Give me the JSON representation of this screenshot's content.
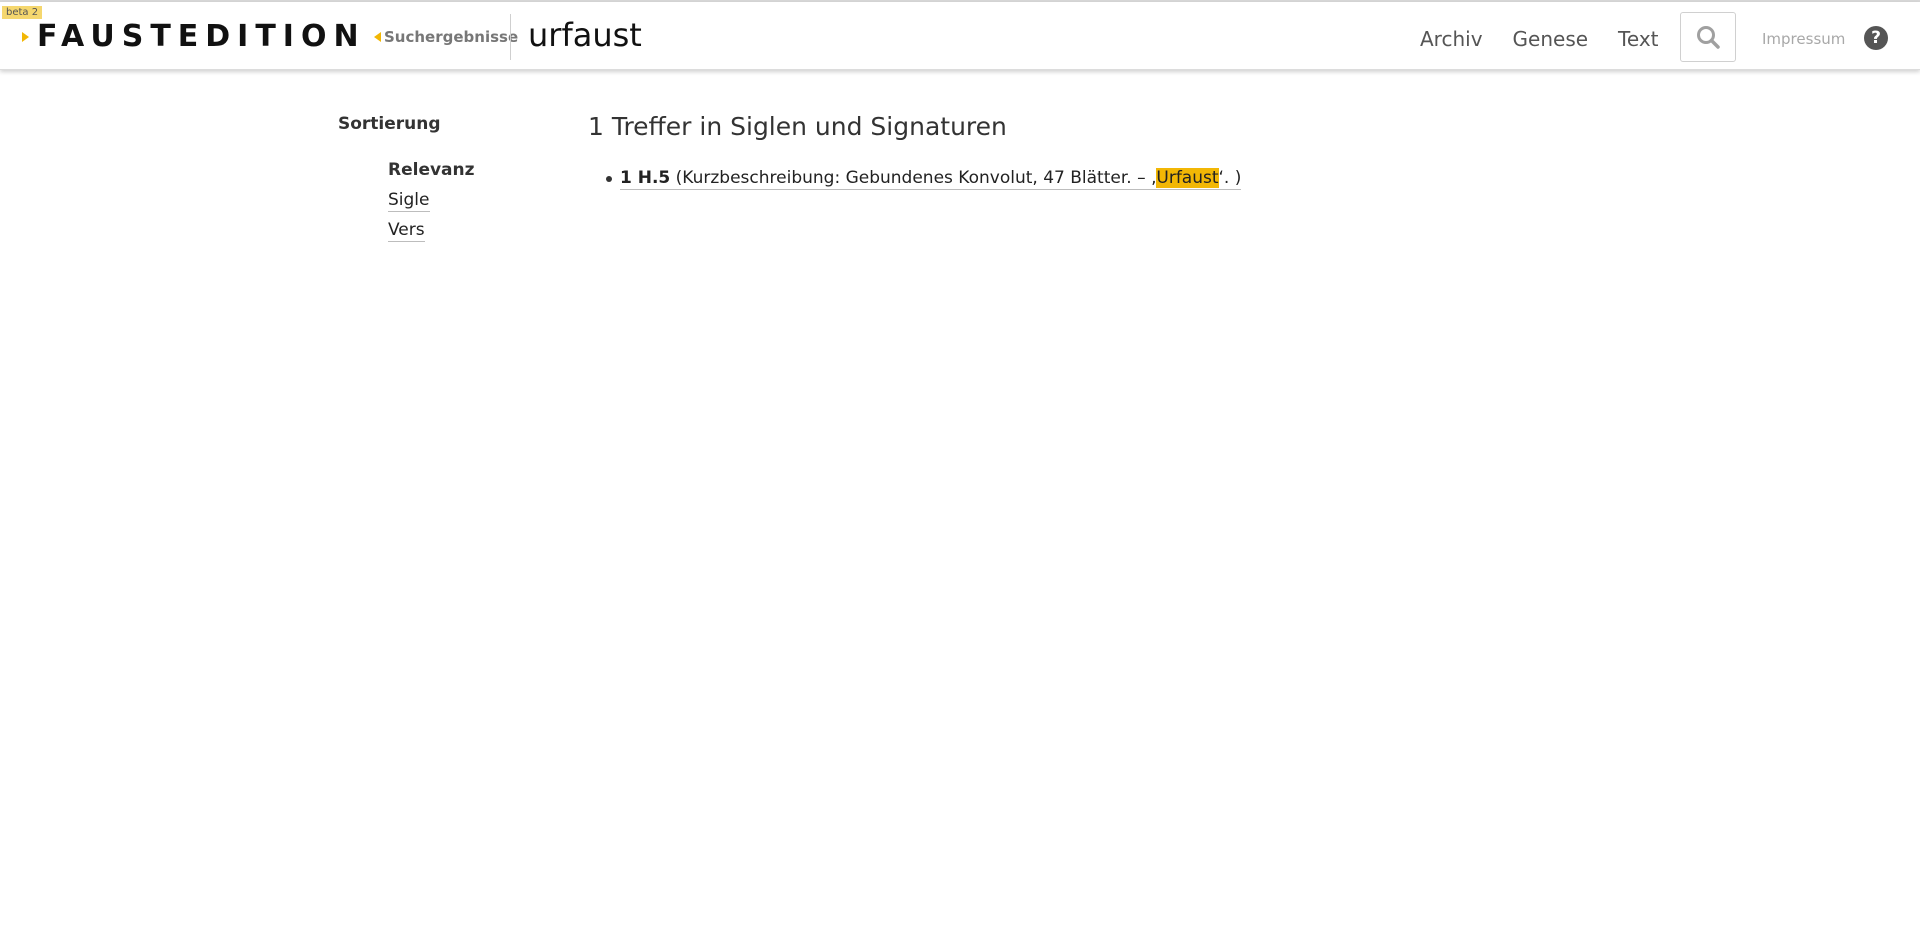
{
  "header": {
    "beta_badge": "beta 2",
    "logo_text": "FAUSTEDITION",
    "breadcrumb": "Suchergebnisse",
    "query_title": "urfaust",
    "nav": {
      "archiv": "Archiv",
      "genese": "Genese",
      "text": "Text"
    },
    "search_icon": "search-icon",
    "impressum": "Impressum",
    "help_icon": "?"
  },
  "sidebar": {
    "heading": "Sortierung",
    "options": {
      "relevanz": "Relevanz",
      "sigle": "Sigle",
      "vers": "Vers"
    },
    "active_option": "Relevanz"
  },
  "results": {
    "heading": "1 Treffer in Siglen und Signaturen",
    "items": [
      {
        "sigil": "1 H.5",
        "desc_before": " (Kurzbeschreibung: Gebundenes Konvolut, 47 Blätter. – ‚",
        "highlight": "Urfaust",
        "desc_after": "‘. )"
      }
    ]
  },
  "colors": {
    "accent": "#f2b705",
    "beta_badge": "#f5d76e",
    "text": "#222222",
    "nav": "#555555",
    "muted": "#a8a8a8"
  }
}
